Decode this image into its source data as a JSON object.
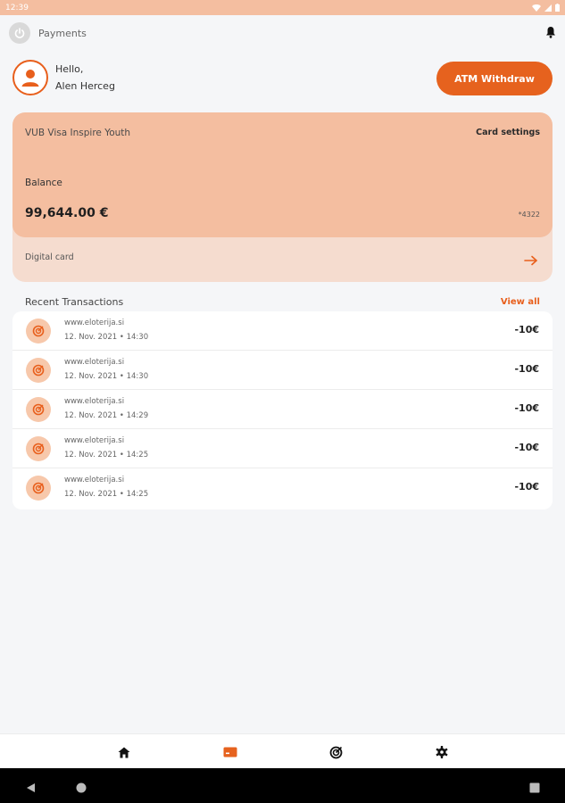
{
  "status_bar": {
    "time": "12:39"
  },
  "header": {
    "title": "Payments"
  },
  "greeting": {
    "hello": "Hello,",
    "name": "Alen Herceg"
  },
  "actions": {
    "atm_withdraw": "ATM Withdraw"
  },
  "card": {
    "name": "VUB Visa Inspire Youth",
    "settings_label": "Card settings",
    "balance_label": "Balance",
    "balance_value": "99,644.00 €",
    "last4": "*4322",
    "digital_card_label": "Digital card"
  },
  "transactions": {
    "title": "Recent Transactions",
    "view_all": "View all",
    "items": [
      {
        "merchant": "www.eloterija.si",
        "date": "12. Nov. 2021 • 14:30",
        "amount": "-10€"
      },
      {
        "merchant": "www.eloterija.si",
        "date": "12. Nov. 2021 • 14:30",
        "amount": "-10€"
      },
      {
        "merchant": "www.eloterija.si",
        "date": "12. Nov. 2021 • 14:29",
        "amount": "-10€"
      },
      {
        "merchant": "www.eloterija.si",
        "date": "12. Nov. 2021 • 14:25",
        "amount": "-10€"
      },
      {
        "merchant": "www.eloterija.si",
        "date": "12. Nov. 2021 • 14:25",
        "amount": "-10€"
      }
    ]
  },
  "bottom_nav": {
    "items": [
      {
        "icon": "home-icon",
        "active": false
      },
      {
        "icon": "card-icon",
        "active": true
      },
      {
        "icon": "dartboard-icon",
        "active": false
      },
      {
        "icon": "gear-icon",
        "active": false
      }
    ]
  },
  "colors": {
    "accent": "#e6621e",
    "card_bg": "#f4bea0",
    "card_footer_bg": "#f5dccf",
    "status_bar_bg": "#f4bea0",
    "background": "#f5f6f8"
  }
}
